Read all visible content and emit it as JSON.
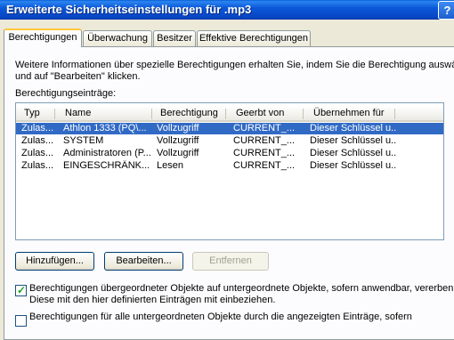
{
  "window": {
    "title": "Erweiterte Sicherheitseinstellungen für .mp3",
    "help_label": "?"
  },
  "tabs": [
    {
      "label": "Berechtigungen"
    },
    {
      "label": "Überwachung"
    },
    {
      "label": "Besitzer"
    },
    {
      "label": "Effektive Berechtigungen"
    }
  ],
  "info": {
    "line1": "Weitere Informationen über spezielle Berechtigungen erhalten Sie, indem Sie die Berechtigung auswählen",
    "line2": "und auf \"Bearbeiten\" klicken."
  },
  "entries_label": "Berechtigungseinträge:",
  "columns": [
    "Typ",
    "Name",
    "Berechtigung",
    "Geerbt von",
    "Übernehmen für"
  ],
  "rows": [
    [
      "Zulas...",
      "Athlon 1333 (PQ\\...",
      "Vollzugriff",
      "CURRENT_...",
      "Dieser Schlüssel u..."
    ],
    [
      "Zulas...",
      "SYSTEM",
      "Vollzugriff",
      "CURRENT_...",
      "Dieser Schlüssel u..."
    ],
    [
      "Zulas...",
      "Administratoren (P...",
      "Vollzugriff",
      "CURRENT_...",
      "Dieser Schlüssel u..."
    ],
    [
      "Zulas...",
      "EINGESCHRÄNK...",
      "Lesen",
      "CURRENT_...",
      "Dieser Schlüssel u..."
    ]
  ],
  "buttons": {
    "add": "Hinzufügen...",
    "edit": "Bearbeiten...",
    "remove": "Entfernen"
  },
  "check1": {
    "line1": "Berechtigungen übergeordneter Objekte auf untergeordnete Objekte, sofern anwendbar, vererben.",
    "line2": "Diese mit den hier definierten Einträgen mit einbeziehen.",
    "checked": true
  },
  "check2": {
    "line1": "Berechtigungen für alle untergeordneten Objekte durch die angezeigten Einträge, sofern",
    "checked": false
  }
}
